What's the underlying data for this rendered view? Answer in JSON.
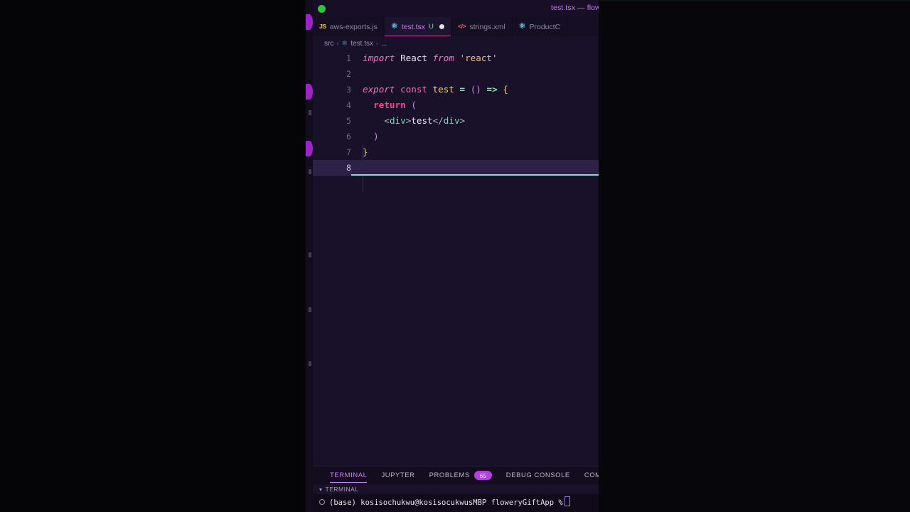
{
  "window": {
    "title": "test.tsx — flow",
    "traffic_lights": [
      "green"
    ]
  },
  "tabs": [
    {
      "label": "aws-exports.js",
      "icon": "js-file-icon",
      "icon_glyph": "JS",
      "active": false,
      "badge": "",
      "dirty": false
    },
    {
      "label": "test.tsx",
      "icon": "react-file-icon",
      "icon_glyph": "⚛",
      "active": true,
      "badge": "U",
      "dirty": true
    },
    {
      "label": "strings.xml",
      "icon": "xml-file-icon",
      "icon_glyph": "</>",
      "active": false,
      "badge": "",
      "dirty": false
    },
    {
      "label": "ProductC",
      "icon": "react-file-icon",
      "icon_glyph": "⚛",
      "active": false,
      "badge": "",
      "dirty": false
    }
  ],
  "breadcrumb": {
    "root": "src",
    "separator": "›",
    "file": "test.tsx",
    "symbol": "..."
  },
  "editor": {
    "language": "typescriptreact",
    "current_line": 8,
    "lines": [
      {
        "no": "1",
        "tokens": [
          {
            "text": "import ",
            "cls": "t-kw"
          },
          {
            "text": "React",
            "cls": "t-var"
          },
          {
            "text": " from ",
            "cls": "t-kw"
          },
          {
            "text": "'react'",
            "cls": "t-str"
          }
        ]
      },
      {
        "no": "2",
        "tokens": []
      },
      {
        "no": "3",
        "tokens": [
          {
            "text": "export ",
            "cls": "t-kw"
          },
          {
            "text": "const",
            "cls": "t-kw2"
          },
          {
            "text": " ",
            "cls": "t-punct"
          },
          {
            "text": "test",
            "cls": "t-fn"
          },
          {
            "text": " ",
            "cls": "t-punct"
          },
          {
            "text": "=",
            "cls": "t-op"
          },
          {
            "text": " ",
            "cls": "t-punct"
          },
          {
            "text": "()",
            "cls": "t-bracket2"
          },
          {
            "text": " ",
            "cls": "t-punct"
          },
          {
            "text": "=>",
            "cls": "t-op"
          },
          {
            "text": " ",
            "cls": "t-punct"
          },
          {
            "text": "{",
            "cls": "t-bracket1"
          }
        ]
      },
      {
        "no": "4",
        "tokens": [
          {
            "text": "  ",
            "cls": "t-punct"
          },
          {
            "text": "return",
            "cls": "t-ctrl"
          },
          {
            "text": " ",
            "cls": "t-punct"
          },
          {
            "text": "(",
            "cls": "t-bracket2"
          }
        ]
      },
      {
        "no": "5",
        "tokens": [
          {
            "text": "    ",
            "cls": "t-punct"
          },
          {
            "text": "<",
            "cls": "t-punct"
          },
          {
            "text": "div",
            "cls": "t-tag"
          },
          {
            "text": ">",
            "cls": "t-punct"
          },
          {
            "text": "test",
            "cls": "t-txt"
          },
          {
            "text": "</",
            "cls": "t-punct"
          },
          {
            "text": "div",
            "cls": "t-tag"
          },
          {
            "text": ">",
            "cls": "t-punct"
          }
        ]
      },
      {
        "no": "6",
        "tokens": [
          {
            "text": "  ",
            "cls": "t-punct"
          },
          {
            "text": ")",
            "cls": "t-bracket2"
          }
        ]
      },
      {
        "no": "7",
        "tokens": [
          {
            "text": "}",
            "cls": "t-bracket1"
          }
        ]
      },
      {
        "no": "8",
        "tokens": []
      }
    ]
  },
  "panel": {
    "tabs": [
      {
        "label": "TERMINAL",
        "active": true,
        "badge": ""
      },
      {
        "label": "JUPYTER",
        "active": false,
        "badge": ""
      },
      {
        "label": "PROBLEMS",
        "active": false,
        "badge": "65"
      },
      {
        "label": "DEBUG CONSOLE",
        "active": false,
        "badge": ""
      },
      {
        "label": "COMMENTS",
        "active": false,
        "badge": ""
      }
    ],
    "section_label": "TERMINAL",
    "terminal_prompt": "(base) kosisochukwu@kosisocukwusMBP floweryGiftApp %"
  },
  "colors": {
    "editor_bg": "#191129",
    "panel_bg": "#100a1a",
    "accent": "#c77dff",
    "current_line_bg": "#2e2147",
    "cursor_line": "#79e2d2",
    "tab_active_underline": "#b3439c",
    "badge_bg": "#b23fe0"
  }
}
